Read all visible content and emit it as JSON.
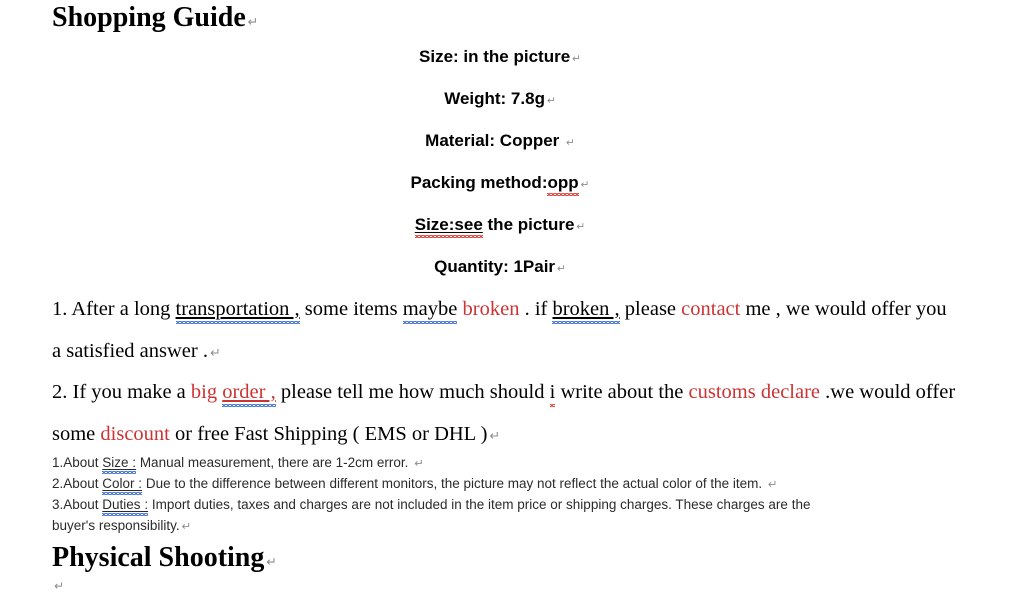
{
  "document": {
    "return_mark": "↵",
    "accent_red": "#cc3333",
    "spell_underline_red": "#e03b2f",
    "grammar_underline_blue": "#3b6fd4",
    "headings": {
      "shopping_guide": "Shopping Guide",
      "physical_shooting": "Physical Shooting"
    },
    "specs": [
      {
        "label": "Size:",
        "value": " in the picture"
      },
      {
        "label": "Weight:",
        "value": " 7.8g"
      },
      {
        "label": "Material:",
        "value": " Copper "
      },
      {
        "label": "Packing method:",
        "value": " opp"
      },
      {
        "label": "Size:see",
        "value": " the picture"
      },
      {
        "label": "Quantity:",
        "value": " 1Pair"
      }
    ],
    "spec_lines_plain": [
      "Size: in the picture",
      "Weight: 7.8g",
      "Material: Copper ",
      "Packing method: opp",
      "Size:see the picture",
      "Quantity: 1Pair"
    ],
    "paragraph1": {
      "number": "1. ",
      "seg_a": "After a long ",
      "transportation": "transportation ,",
      "seg_b": " some items ",
      "maybe": "maybe",
      "seg_c": " ",
      "broken1": "broken",
      "seg_d": " . if ",
      "broken2": "broken ,",
      "seg_e": " please ",
      "contact": "contact",
      "seg_f": " me , we would offer you",
      "line2": "a satisfied answer ."
    },
    "paragraph2": {
      "number": "2. ",
      "seg_a": "If you make a ",
      "big": "big ",
      "order": "order ,",
      "seg_b": " please tell me how much should ",
      "i": "i",
      "seg_c": " write about the ",
      "customs": "customs declare",
      "seg_d": " .we would offer",
      "line2_a": "some ",
      "discount": "discount",
      "line2_b": " or free Fast Shipping ( EMS or DHL )"
    },
    "notes": [
      {
        "prefix": "1.About ",
        "term": "Size :",
        "text": " Manual measurement, there are 1-2cm error.",
        "trailing_spacer": "      ",
        "mark": true
      },
      {
        "prefix": "2.About ",
        "term": "Color :",
        "text": " Due to the difference between different monitors, the picture may not reflect the actual color of the item. ",
        "trailing_spacer": " ",
        "mark": true
      },
      {
        "prefix": "3.About ",
        "term": "Duties :",
        "text": " Import duties, taxes and charges are not included in the item price or shipping charges. These charges are the",
        "trailing_spacer": "",
        "mark": false
      }
    ],
    "notes_wrap_line": "buyer's responsibility."
  }
}
